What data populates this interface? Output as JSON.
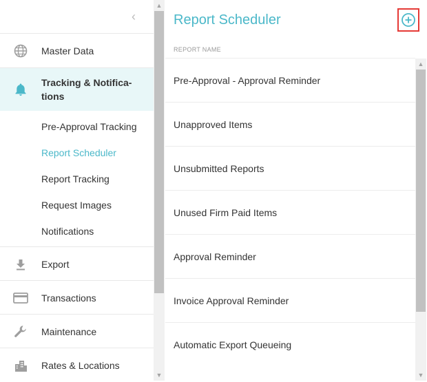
{
  "sidebar": {
    "nav": [
      {
        "label": "Master Data",
        "icon": "globe-icon"
      },
      {
        "label": "Tracking & Notifica-tions",
        "label_line1": "Tracking & Notifica-",
        "label_line2": "tions",
        "icon": "bell-icon",
        "active": true
      },
      {
        "label": "Export",
        "icon": "download-icon"
      },
      {
        "label": "Transactions",
        "icon": "credit-card-icon"
      },
      {
        "label": "Maintenance",
        "icon": "wrench-icon"
      },
      {
        "label": "Rates & Locations",
        "icon": "city-icon"
      }
    ],
    "sub_items": [
      {
        "label": "Pre-Approval Tracking"
      },
      {
        "label": "Report Scheduler",
        "current": true
      },
      {
        "label": "Report Tracking"
      },
      {
        "label": "Request Images"
      },
      {
        "label": "Notifications"
      }
    ]
  },
  "main": {
    "title": "Report Scheduler",
    "column_header": "REPORT NAME",
    "reports": [
      "Pre-Approval - Approval Reminder",
      "Unapproved Items",
      "Unsubmitted Reports",
      "Unused Firm Paid Items",
      "Approval Reminder",
      "Invoice Approval Reminder",
      "Automatic Export Queueing"
    ]
  },
  "colors": {
    "accent": "#4bb8c9",
    "active_bg": "#e8f7f8",
    "highlight": "#e53935"
  }
}
